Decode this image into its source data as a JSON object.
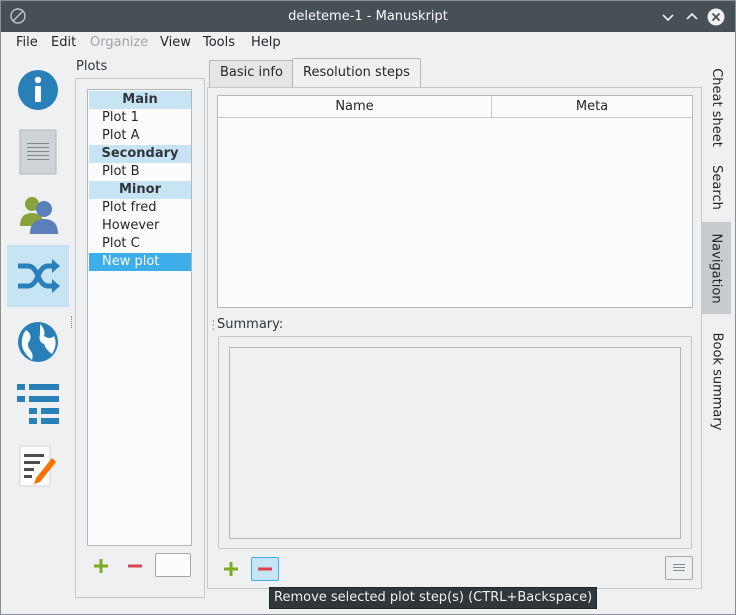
{
  "window": {
    "title": "deleteme-1 - Manuskript"
  },
  "menubar": {
    "items": [
      {
        "label": "File",
        "disabled": false
      },
      {
        "label": "Edit",
        "disabled": false
      },
      {
        "label": "Organize",
        "disabled": true
      },
      {
        "label": "View",
        "disabled": false
      },
      {
        "label": "Tools",
        "disabled": false
      },
      {
        "label": "Help",
        "disabled": false
      }
    ]
  },
  "left_nav": {
    "items": [
      {
        "icon": "info-icon",
        "active": false
      },
      {
        "icon": "summary-icon",
        "active": false
      },
      {
        "icon": "characters-icon",
        "active": false
      },
      {
        "icon": "plots-shuffle-icon",
        "active": true
      },
      {
        "icon": "world-icon",
        "active": false
      },
      {
        "icon": "outline-icon",
        "active": false
      },
      {
        "icon": "editor-icon",
        "active": false
      }
    ]
  },
  "plots": {
    "label": "Plots",
    "rows": [
      {
        "text": "Main",
        "type": "header"
      },
      {
        "text": "Plot 1",
        "type": "item"
      },
      {
        "text": "Plot A",
        "type": "item"
      },
      {
        "text": "Secondary",
        "type": "header"
      },
      {
        "text": "Plot B",
        "type": "item"
      },
      {
        "text": "Minor",
        "type": "header"
      },
      {
        "text": "Plot fred",
        "type": "item"
      },
      {
        "text": "However",
        "type": "item"
      },
      {
        "text": "Plot C",
        "type": "item"
      },
      {
        "text": "New plot",
        "type": "selected"
      }
    ]
  },
  "tabs": {
    "basic_info": "Basic info",
    "resolution_steps": "Resolution steps"
  },
  "steps_table": {
    "columns": [
      "Name",
      "Meta"
    ]
  },
  "summary": {
    "label": "Summary:"
  },
  "right_tabs": [
    {
      "label": "Cheat sheet",
      "active": false
    },
    {
      "label": "Search",
      "active": false
    },
    {
      "label": "Navigation",
      "active": true
    },
    {
      "label": "Book summary",
      "active": false
    }
  ],
  "tooltip": {
    "text": "Remove selected plot step(s) (CTRL+Backspace)"
  },
  "colors": {
    "accent": "#3daee9",
    "header_bg": "#c7e4f4",
    "add_green": "#7bab20",
    "remove_red": "#da4453",
    "titlebar": "#475057"
  }
}
